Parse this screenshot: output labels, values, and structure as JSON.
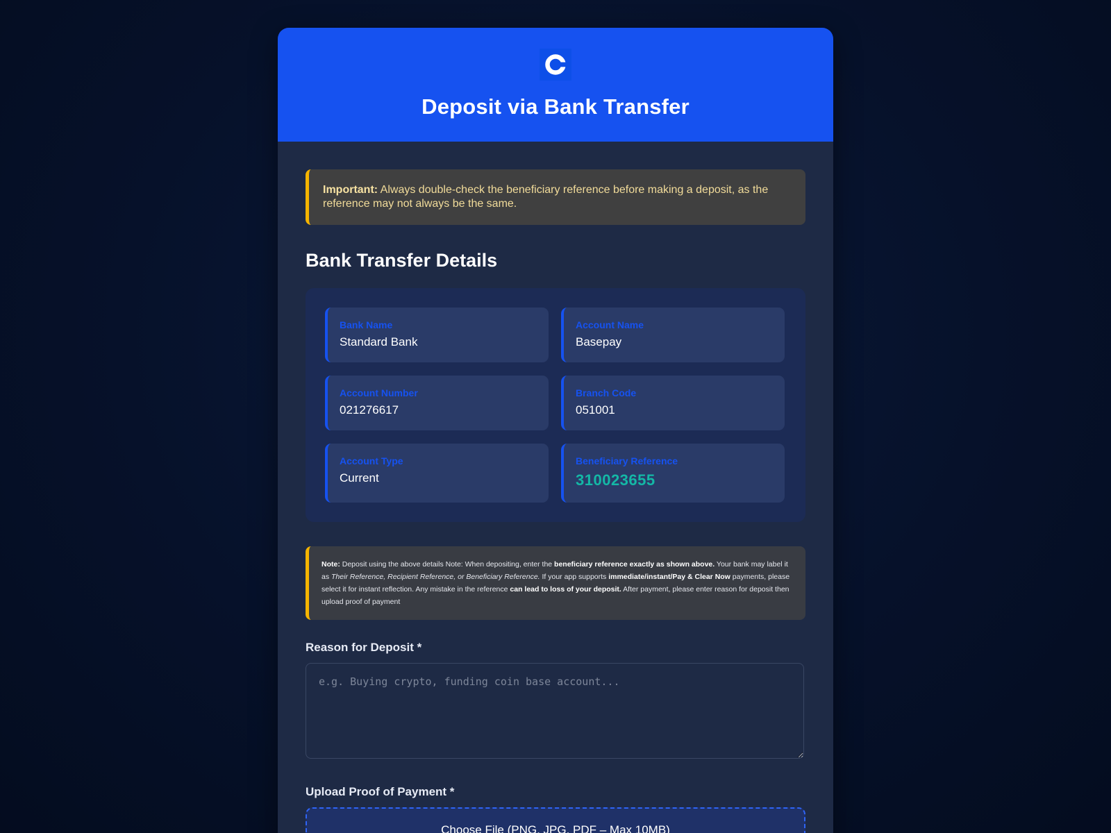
{
  "header": {
    "logo_icon": "coinbase-logo",
    "title": "Deposit via Bank Transfer"
  },
  "alert": {
    "label": "Important:",
    "text": "Always double-check the beneficiary reference before making a deposit, as the reference may not always be the same."
  },
  "section": {
    "title": "Bank Transfer Details"
  },
  "details": [
    {
      "label": "Bank Name",
      "value": "Standard Bank"
    },
    {
      "label": "Account Name",
      "value": "Basepay"
    },
    {
      "label": "Account Number",
      "value": "021276617"
    },
    {
      "label": "Branch Code",
      "value": "051001"
    },
    {
      "label": "Account Type",
      "value": "Current"
    },
    {
      "label": "Beneficiary Reference",
      "value": "310023655"
    }
  ],
  "note": {
    "label": "Note:",
    "p1": " Deposit using the above details Note: When depositing, enter the ",
    "b1": "beneficiary reference exactly as shown above.",
    "p2": " Your bank may label it as ",
    "i1": "Their Reference, Recipient Reference, or Beneficiary Reference.",
    "p3": " If your app supports ",
    "b2": "immediate/instant/Pay & Clear Now",
    "p4": " payments, please select it for instant reflection. Any mistake in the reference ",
    "b3": "can lead to loss of your deposit.",
    "p5": " After payment, please enter reason for deposit then upload proof of payment"
  },
  "reason": {
    "label": "Reason for Deposit *",
    "placeholder": "e.g. Buying crypto, funding coin base account..."
  },
  "upload": {
    "label": "Upload Proof of Payment *",
    "button_text": "Choose File (PNG, JPG, PDF – Max 10MB)"
  },
  "colors": {
    "brand_blue": "#1652f0",
    "accent_teal": "#14b8a6",
    "warning_yellow": "#f5b400"
  }
}
